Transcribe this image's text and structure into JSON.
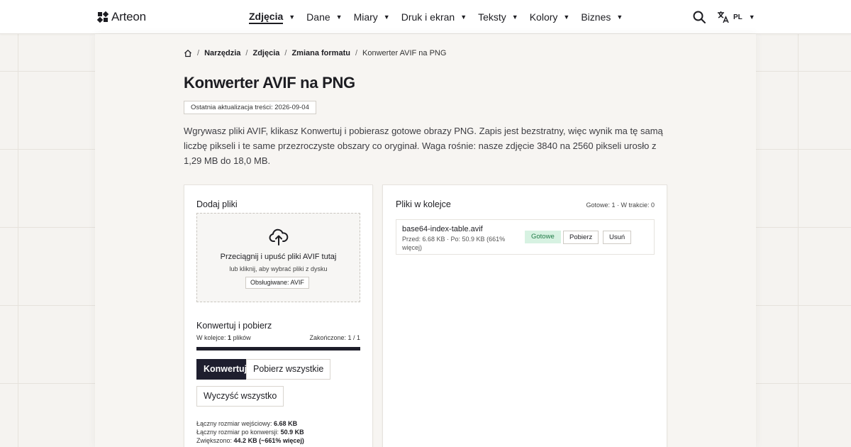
{
  "header": {
    "logo_text": "Arteon",
    "nav": [
      {
        "label": "Zdjęcia",
        "active": true
      },
      {
        "label": "Dane",
        "active": false
      },
      {
        "label": "Miary",
        "active": false
      },
      {
        "label": "Druk i ekran",
        "active": false
      },
      {
        "label": "Teksty",
        "active": false
      },
      {
        "label": "Kolory",
        "active": false
      },
      {
        "label": "Biznes",
        "active": false
      }
    ],
    "language": "PL"
  },
  "breadcrumb": {
    "items": [
      "Narzędzia",
      "Zdjęcia",
      "Zmiana formatu"
    ],
    "current": "Konwerter AVIF na PNG"
  },
  "page": {
    "title": "Konwerter AVIF na PNG",
    "updated": "Ostatnia aktualizacja treści: 2026-09-04",
    "intro": "Wgrywasz pliki AVIF, klikasz Konwertuj i pobierasz gotowe obrazy PNG. Zapis jest bezstratny, więc wynik ma tę samą liczbę pikseli i te same przezroczyste obszary co oryginał. Waga rośnie: nasze zdjęcie 3840 na 2560 pikseli urosło z 1,29 MB do 18,0 MB."
  },
  "upload": {
    "heading": "Dodaj pliki",
    "drop_title": "Przeciągnij i upuść pliki AVIF tutaj",
    "drop_sub": "lub kliknij, aby wybrać pliki z dysku",
    "supported": "Obsługiwane: AVIF"
  },
  "convert": {
    "heading": "Konwertuj i pobierz",
    "queue_label": "W kolejce:",
    "queue_count": "1",
    "queue_unit": "plików",
    "done_label": "Zakończone: 1 / 1",
    "progress": 1.0,
    "btn_convert": "Konwertuj",
    "btn_download_all": "Pobierz wszystkie",
    "btn_clear": "Wyczyść wszystko"
  },
  "summary": {
    "input_label": "Łączny rozmiar wejściowy:",
    "input_value": "6.68 KB",
    "output_label": "Łączny rozmiar po konwersji:",
    "output_value": "50.9 KB",
    "increase_label": "Zwiększono:",
    "increase_value": "44.2 KB (~661% więcej)"
  },
  "queue": {
    "heading": "Pliki w kolejce",
    "stats": "Gotowe: 1 · W trakcie: 0",
    "files": [
      {
        "name": "base64-index-table.avif",
        "meta": "Przed: 6.68 KB · Po: 50.9 KB (661% więcej)",
        "status": "Gotowe",
        "download": "Pobierz",
        "remove": "Usuń"
      }
    ]
  },
  "colors": {
    "primary": "#1e1e2e",
    "success_bg": "#d7f2e2",
    "success_text": "#1f7a46",
    "background": "#f5f3f0"
  }
}
